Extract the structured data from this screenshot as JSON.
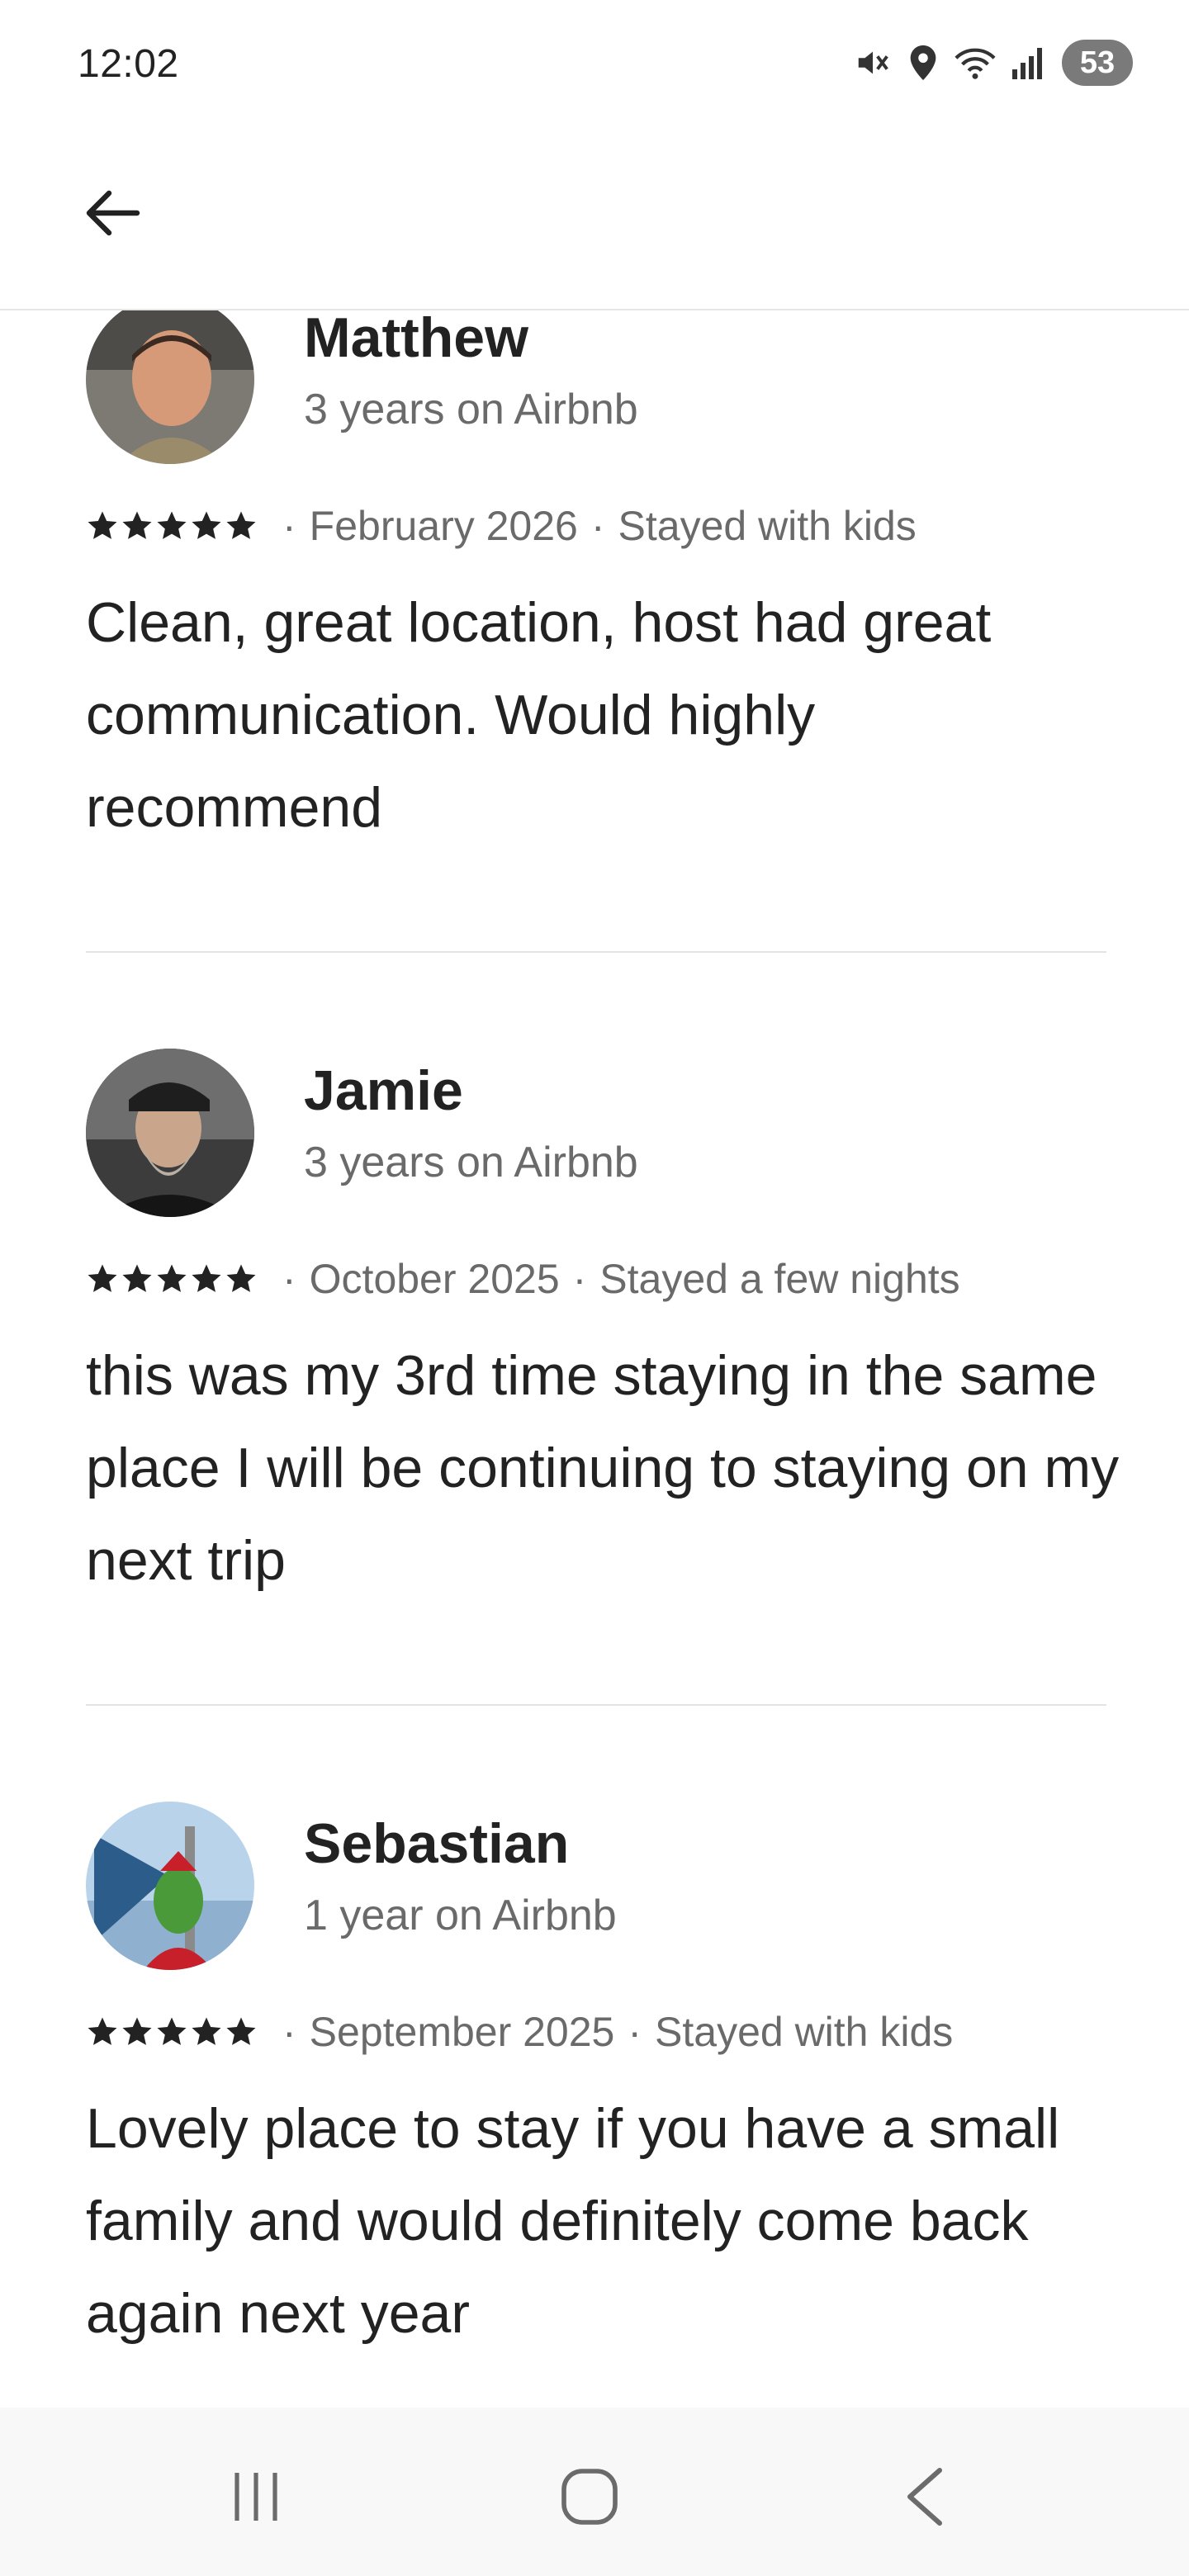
{
  "status_bar": {
    "time": "12:02",
    "battery": "53",
    "icons": [
      "mute-icon",
      "location-icon",
      "wifi-icon",
      "signal-icon"
    ]
  },
  "header": {
    "back_icon": "arrow-left-icon"
  },
  "reviews": [
    {
      "name": "Matthew",
      "tenure": "3 years on Airbnb",
      "rating": 5,
      "date": "February 2026",
      "stay_type": "Stayed with kids",
      "text": "Clean, great location, host had great communication. Would highly recommend"
    },
    {
      "name": "Jamie",
      "tenure": "3 years on Airbnb",
      "rating": 5,
      "date": "October 2025",
      "stay_type": "Stayed a few nights",
      "text": "this was my 3rd time staying in the same place I will be continuing to staying on my next trip"
    },
    {
      "name": "Sebastian",
      "tenure": "1 year on Airbnb",
      "rating": 5,
      "date": "September 2025",
      "stay_type": "Stayed with kids",
      "text": "Lovely place to stay if you have a small family and would definitely come back again next year"
    }
  ],
  "nav_bar": {
    "recents_icon": "recents-icon",
    "home_icon": "home-icon",
    "back_icon": "back-chevron-icon"
  },
  "colors": {
    "text_primary": "#222222",
    "text_secondary": "#6a6a6a",
    "divider": "#e3e3e3"
  }
}
